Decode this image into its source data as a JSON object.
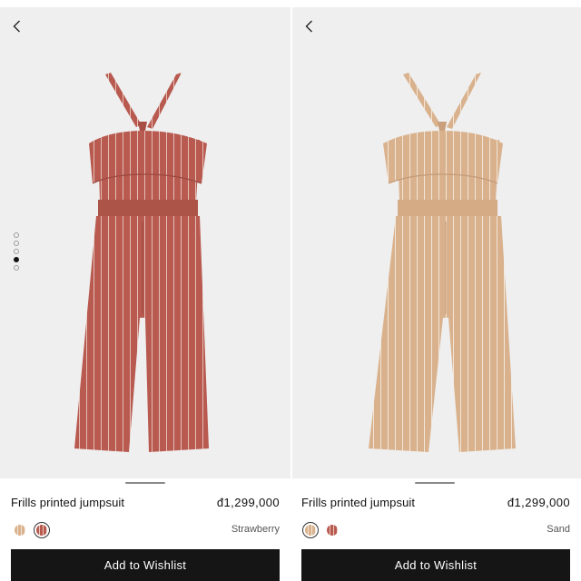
{
  "colors": {
    "strawberry": "#b85a4f",
    "sand": "#d9b28d",
    "button_bg": "#151515",
    "image_bg": "#efefef"
  },
  "icons": {
    "back": "chevron-left-icon"
  },
  "gallery": {
    "image_count": 5,
    "active_index": 3
  },
  "products": [
    {
      "name": "Frills printed jumpsuit",
      "price": "đ1,299,000",
      "color_name": "Strawberry",
      "swatches": [
        "sand",
        "strawberry"
      ],
      "selected_swatch": "strawberry",
      "wishlist_label": "Add to Wishlist"
    },
    {
      "name": "Frills printed jumpsuit",
      "price": "đ1,299,000",
      "color_name": "Sand",
      "swatches": [
        "sand",
        "strawberry"
      ],
      "selected_swatch": "sand",
      "wishlist_label": "Add to Wishlist"
    }
  ]
}
